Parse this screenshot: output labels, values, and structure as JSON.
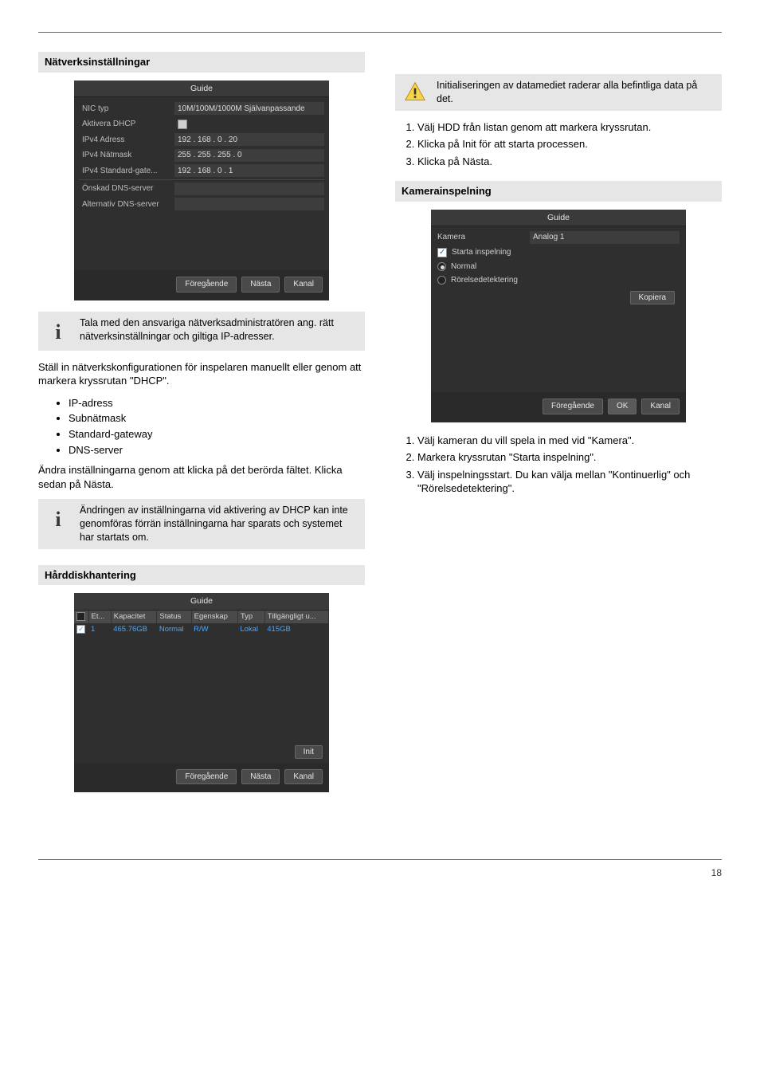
{
  "page_number": "18",
  "left": {
    "network_heading": "Nätverksinställningar",
    "wizard1": {
      "title": "Guide",
      "rows": [
        {
          "label": "NIC typ",
          "value": "10M/100M/1000M Självanpassande"
        },
        {
          "label": "Aktivera DHCP",
          "checkbox": true
        },
        {
          "label": "IPv4 Adress",
          "value": "192 . 168 . 0   . 20"
        },
        {
          "label": "IPv4 Nätmask",
          "value": "255 . 255 . 255 . 0"
        },
        {
          "label": "IPv4 Standard-gate...",
          "value": "192 . 168 . 0   . 1"
        },
        {
          "label": "Önskad DNS-server",
          "value": ""
        },
        {
          "label": "Alternativ DNS-server",
          "value": ""
        }
      ],
      "buttons": {
        "prev": "Föregående",
        "next": "Nästa",
        "cancel": "Kanal"
      }
    },
    "info_network": "Tala med den ansvariga nätverksadministratören ang. rätt nätverksinställningar och giltiga IP-adresser.",
    "summary": {
      "intro": "Ställ in nätverkskonfigurationen för inspelaren manuellt eller genom att markera kryssrutan \"DHCP\".",
      "items": [
        "IP-adress",
        "Subnätmask",
        "Standard-gateway",
        "DNS-server"
      ],
      "outro": "Ändra inställningarna genom att klicka på det berörda fältet. Klicka sedan på Nästa."
    },
    "info_dhcp": "Ändringen av inställningarna vid aktivering av DHCP kan inte genomföras förrän inställningarna har sparats och systemet har startats om.",
    "hdd_heading": "Hårddiskhantering",
    "wizard2": {
      "title": "Guide",
      "headers": [
        "",
        "Et...",
        "Kapacitet",
        "Status",
        "Egenskap",
        "Typ",
        "Tillgängligt u..."
      ],
      "row": {
        "id": "1",
        "cap": "465.76GB",
        "status": "Normal",
        "prop": "R/W",
        "type": "Lokal",
        "free": "415GB"
      },
      "init": "Init",
      "buttons": {
        "prev": "Föregående",
        "next": "Nästa",
        "cancel": "Kanal"
      }
    }
  },
  "right": {
    "warn": "Initialiseringen av datamediet raderar alla befintliga data på det.",
    "hdd_steps": [
      "Välj HDD från listan genom att markera kryssrutan.",
      "Klicka på Init för att starta processen.",
      "Klicka på Nästa."
    ],
    "rec_heading": "Kamerainspelning",
    "wizard3": {
      "title": "Guide",
      "camera_label": "Kamera",
      "camera_value": "Analog 1",
      "start_rec": "Starta inspelning",
      "normal": "Normal",
      "motion": "Rörelsedetektering",
      "kopiera": "Kopiera",
      "buttons": {
        "prev": "Föregående",
        "ok": "OK",
        "cancel": "Kanal"
      }
    },
    "rec_steps": [
      "Välj kameran du vill spela in med vid \"Kamera\".",
      "Markera kryssrutan \"Starta inspelning\".",
      "Välj inspelningsstart. Du kan välja mellan \"Kontinuerlig\" och \"Rörelsedetektering\"."
    ]
  }
}
